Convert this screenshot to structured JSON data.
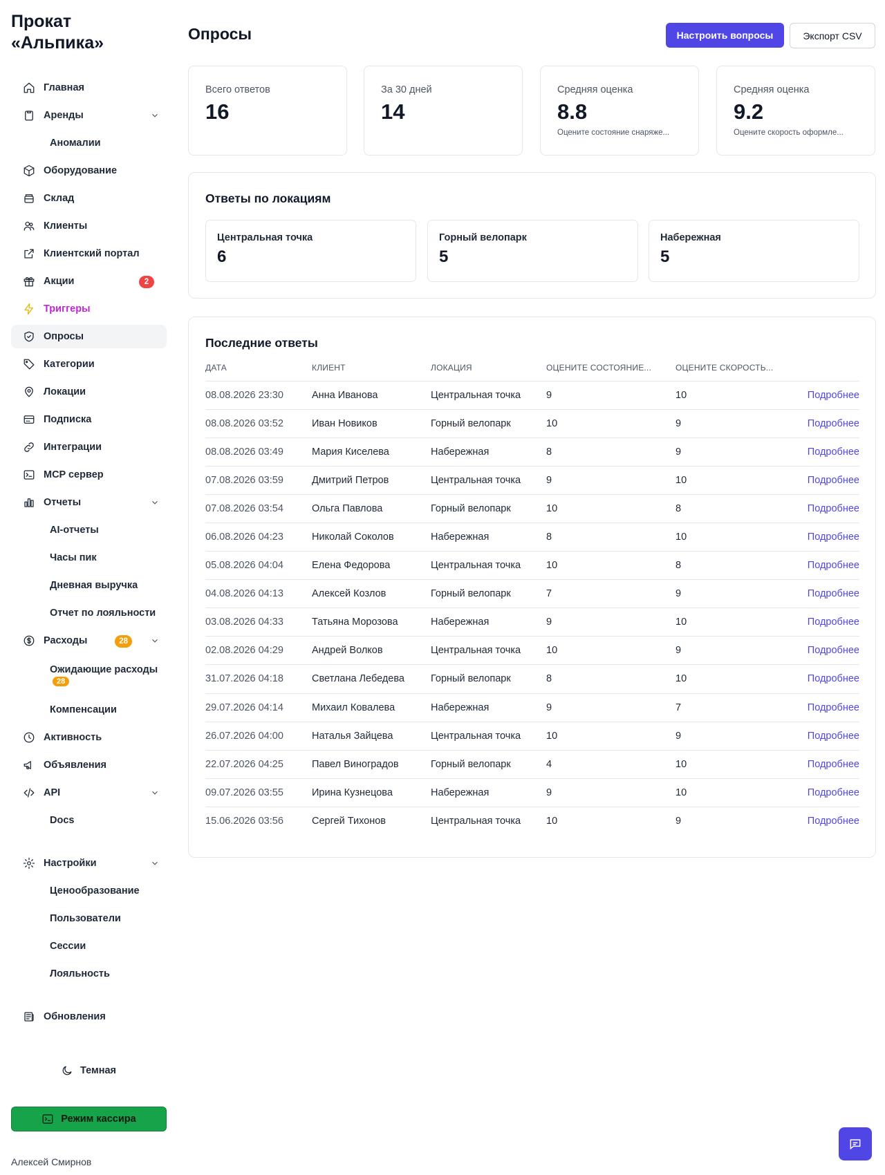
{
  "brand": "Прокат «Альпика»",
  "sidebar": {
    "items": [
      {
        "label": "Главная"
      },
      {
        "label": "Аренды"
      },
      {
        "label": "Аномалии"
      },
      {
        "label": "Оборудование"
      },
      {
        "label": "Склад"
      },
      {
        "label": "Клиенты"
      },
      {
        "label": "Клиентский портал"
      },
      {
        "label": "Акции",
        "badge": "2"
      },
      {
        "label": "Триггеры"
      },
      {
        "label": "Опросы"
      },
      {
        "label": "Категории"
      },
      {
        "label": "Локации"
      },
      {
        "label": "Подписка"
      },
      {
        "label": "Интеграции"
      },
      {
        "label": "MCP сервер"
      },
      {
        "label": "Отчеты"
      },
      {
        "label": "AI-отчеты"
      },
      {
        "label": "Часы пик"
      },
      {
        "label": "Дневная выручка"
      },
      {
        "label": "Отчет по лояльности"
      },
      {
        "label": "Расходы",
        "badge": "28"
      },
      {
        "label": "Ожидающие расходы",
        "badge": "28"
      },
      {
        "label": "Компенсации"
      },
      {
        "label": "Активность"
      },
      {
        "label": "Объявления"
      },
      {
        "label": "API"
      },
      {
        "label": "Docs"
      },
      {
        "label": "Настройки"
      },
      {
        "label": "Ценообразование"
      },
      {
        "label": "Пользователи"
      },
      {
        "label": "Сессии"
      },
      {
        "label": "Лояльность"
      },
      {
        "label": "Обновления"
      }
    ],
    "theme_label": "Темная",
    "cashier_label": "Режим кассира",
    "user_name": "Алексей Смирнов"
  },
  "header": {
    "title": "Опросы",
    "configure_label": "Настроить вопросы",
    "export_label": "Экспорт CSV"
  },
  "stats": [
    {
      "label": "Всего ответов",
      "value": "16",
      "sub": ""
    },
    {
      "label": "За 30 дней",
      "value": "14",
      "sub": ""
    },
    {
      "label": "Средняя оценка",
      "value": "8.8",
      "sub": "Оцените состояние снаряже..."
    },
    {
      "label": "Средняя оценка",
      "value": "9.2",
      "sub": "Оцените скорость оформле..."
    }
  ],
  "locations": {
    "title": "Ответы по локациям",
    "items": [
      {
        "name": "Центральная точка",
        "count": "6"
      },
      {
        "name": "Горный велопарк",
        "count": "5"
      },
      {
        "name": "Набережная",
        "count": "5"
      }
    ]
  },
  "responses": {
    "title": "Последние ответы",
    "columns": [
      "ДАТА",
      "КЛИЕНТ",
      "ЛОКАЦИЯ",
      "ОЦЕНИТЕ СОСТОЯНИЕ...",
      "ОЦЕНИТЕ СКОРОСТЬ..."
    ],
    "link_label": "Подробнее",
    "rows": [
      {
        "date": "08.08.2026 23:30",
        "client": "Анна Иванова",
        "location": "Центральная точка",
        "q1": "9",
        "q2": "10"
      },
      {
        "date": "08.08.2026 03:52",
        "client": "Иван Новиков",
        "location": "Горный велопарк",
        "q1": "10",
        "q2": "9"
      },
      {
        "date": "08.08.2026 03:49",
        "client": "Мария Киселева",
        "location": "Набережная",
        "q1": "8",
        "q2": "9"
      },
      {
        "date": "07.08.2026 03:59",
        "client": "Дмитрий Петров",
        "location": "Центральная точка",
        "q1": "9",
        "q2": "10"
      },
      {
        "date": "07.08.2026 03:54",
        "client": "Ольга Павлова",
        "location": "Горный велопарк",
        "q1": "10",
        "q2": "8"
      },
      {
        "date": "06.08.2026 04:23",
        "client": "Николай Соколов",
        "location": "Набережная",
        "q1": "8",
        "q2": "10"
      },
      {
        "date": "05.08.2026 04:04",
        "client": "Елена Федорова",
        "location": "Центральная точка",
        "q1": "10",
        "q2": "8"
      },
      {
        "date": "04.08.2026 04:13",
        "client": "Алексей Козлов",
        "location": "Горный велопарк",
        "q1": "7",
        "q2": "9"
      },
      {
        "date": "03.08.2026 04:33",
        "client": "Татьяна Морозова",
        "location": "Набережная",
        "q1": "9",
        "q2": "10"
      },
      {
        "date": "02.08.2026 04:29",
        "client": "Андрей Волков",
        "location": "Центральная точка",
        "q1": "10",
        "q2": "9"
      },
      {
        "date": "31.07.2026 04:18",
        "client": "Светлана Лебедева",
        "location": "Горный велопарк",
        "q1": "8",
        "q2": "10"
      },
      {
        "date": "29.07.2026 04:14",
        "client": "Михаил Ковалева",
        "location": "Набережная",
        "q1": "9",
        "q2": "7"
      },
      {
        "date": "26.07.2026 04:00",
        "client": "Наталья Зайцева",
        "location": "Центральная точка",
        "q1": "10",
        "q2": "9"
      },
      {
        "date": "22.07.2026 04:25",
        "client": "Павел Виноградов",
        "location": "Горный велопарк",
        "q1": "4",
        "q2": "10"
      },
      {
        "date": "09.07.2026 03:55",
        "client": "Ирина Кузнецова",
        "location": "Набережная",
        "q1": "9",
        "q2": "10"
      },
      {
        "date": "15.06.2026 03:56",
        "client": "Сергей Тихонов",
        "location": "Центральная точка",
        "q1": "10",
        "q2": "9"
      }
    ]
  },
  "colors": {
    "accent": "#4f46e5",
    "cashier": "#16a34a",
    "badge_red": "#ef4444",
    "badge_orange": "#f59e0b"
  }
}
